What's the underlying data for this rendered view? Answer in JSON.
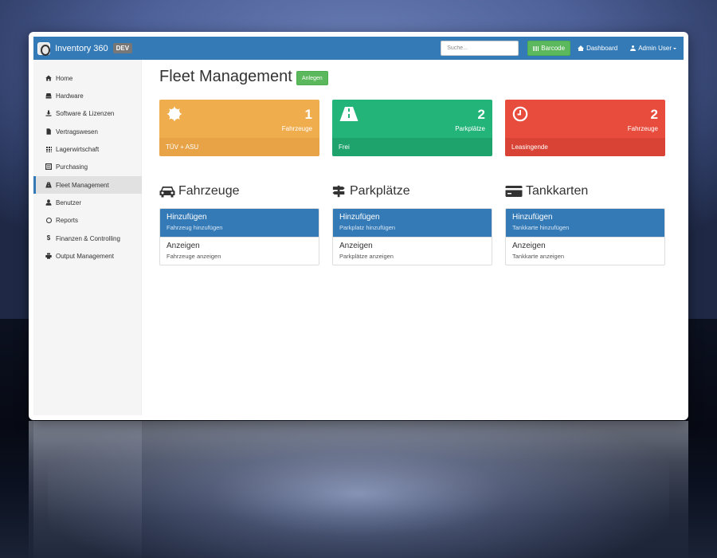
{
  "app": {
    "name": "Inventory 360",
    "env_badge": "DEV"
  },
  "navbar": {
    "search_placeholder": "Suche...",
    "barcode_label": "Barcode",
    "dashboard_label": "Dashboard",
    "user_label": "Admin User"
  },
  "sidebar": {
    "active": "Fleet Management",
    "items": [
      {
        "label": "Home",
        "icon": "home-icon"
      },
      {
        "label": "Hardware",
        "icon": "hdd-icon"
      },
      {
        "label": "Software & Lizenzen",
        "icon": "download-icon"
      },
      {
        "label": "Vertragswesen",
        "icon": "file-icon"
      },
      {
        "label": "Lagerwirtschaft",
        "icon": "grid-icon"
      },
      {
        "label": "Purchasing",
        "icon": "list-alt-icon"
      },
      {
        "label": "Fleet Management",
        "icon": "road-icon"
      },
      {
        "label": "Benutzer",
        "icon": "user-icon"
      },
      {
        "label": "Reports",
        "icon": "clock-icon"
      },
      {
        "label": "Finanzen & Controlling",
        "icon": "dollar-icon"
      },
      {
        "label": "Output Management",
        "icon": "print-icon"
      }
    ]
  },
  "main": {
    "title": "Fleet Management",
    "add_button": "Anlegen",
    "stats": [
      {
        "value": "1",
        "label": "Fahrzeuge",
        "footer": "TÜV + ASU",
        "icon": "certificate-icon",
        "color": "#f0ad4e"
      },
      {
        "value": "2",
        "label": "Parkplätze",
        "footer": "Frei",
        "icon": "road-icon",
        "color": "#23b47a"
      },
      {
        "value": "2",
        "label": "Fahrzeuge",
        "footer": "Leasingende",
        "icon": "clock-icon",
        "color": "#e74c3c"
      }
    ],
    "sections": [
      {
        "title": "Fahrzeuge",
        "icon": "car-icon",
        "add_heading": "Hinzufügen",
        "add_text": "Fahrzeug hinzufügen",
        "view_heading": "Anzeigen",
        "view_text": "Fahrzeuge anzeigen"
      },
      {
        "title": "Parkplätze",
        "icon": "signpost-icon",
        "add_heading": "Hinzufügen",
        "add_text": "Parkplatz hinzufügen",
        "view_heading": "Anzeigen",
        "view_text": "Parkplätze anzeigen"
      },
      {
        "title": "Tankkarten",
        "icon": "credit-card-icon",
        "add_heading": "Hinzufügen",
        "add_text": "Tankkarte hinzufügen",
        "view_heading": "Anzeigen",
        "view_text": "Tankkarte anzeigen"
      }
    ]
  },
  "colors": {
    "primary": "#337ab7",
    "success": "#5cb85c",
    "warning": "#f0ad4e",
    "teal": "#23b47a",
    "danger": "#e74c3c"
  }
}
